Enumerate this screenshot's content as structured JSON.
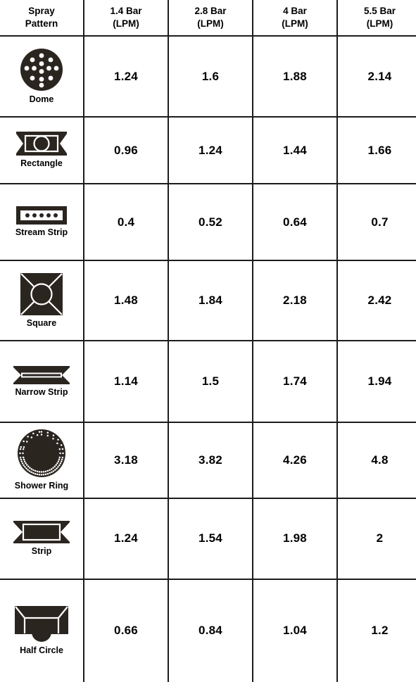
{
  "table": {
    "columns": [
      {
        "id": "pattern",
        "line1": "Spray",
        "line2": "Pattern"
      },
      {
        "id": "bar_1_4",
        "line1": "1.4 Bar",
        "line2": "(LPM)"
      },
      {
        "id": "bar_2_8",
        "line1": "2.8 Bar",
        "line2": "(LPM)"
      },
      {
        "id": "bar_4",
        "line1": "4 Bar",
        "line2": "(LPM)"
      },
      {
        "id": "bar_5_5",
        "line1": "5.5 Bar",
        "line2": "(LPM)"
      }
    ],
    "rows": [
      {
        "pattern": "Dome",
        "icon": "dome-icon",
        "bar_1_4": "1.24",
        "bar_2_8": "1.6",
        "bar_4": "1.88",
        "bar_5_5": "2.14"
      },
      {
        "pattern": "Rectangle",
        "icon": "rectangle-icon",
        "bar_1_4": "0.96",
        "bar_2_8": "1.24",
        "bar_4": "1.44",
        "bar_5_5": "1.66"
      },
      {
        "pattern": "Stream Strip",
        "icon": "stream-strip-icon",
        "bar_1_4": "0.4",
        "bar_2_8": "0.52",
        "bar_4": "0.64",
        "bar_5_5": "0.7"
      },
      {
        "pattern": "Square",
        "icon": "square-icon",
        "bar_1_4": "1.48",
        "bar_2_8": "1.84",
        "bar_4": "2.18",
        "bar_5_5": "2.42"
      },
      {
        "pattern": "Narrow Strip",
        "icon": "narrow-strip-icon",
        "bar_1_4": "1.14",
        "bar_2_8": "1.5",
        "bar_4": "1.74",
        "bar_5_5": "1.94"
      },
      {
        "pattern": "Shower Ring",
        "icon": "shower-ring-icon",
        "bar_1_4": "3.18",
        "bar_2_8": "3.82",
        "bar_4": "4.26",
        "bar_5_5": "4.8"
      },
      {
        "pattern": "Strip",
        "icon": "strip-icon",
        "bar_1_4": "1.24",
        "bar_2_8": "1.54",
        "bar_4": "1.98",
        "bar_5_5": "2"
      },
      {
        "pattern": "Half Circle",
        "icon": "half-circle-icon",
        "bar_1_4": "0.66",
        "bar_2_8": "0.84",
        "bar_4": "1.04",
        "bar_5_5": "1.2"
      }
    ]
  },
  "colors": {
    "icon_dark": "#2B2520",
    "grid_line": "#1c1c1c",
    "background": "#ffffff",
    "text": "#000000"
  }
}
